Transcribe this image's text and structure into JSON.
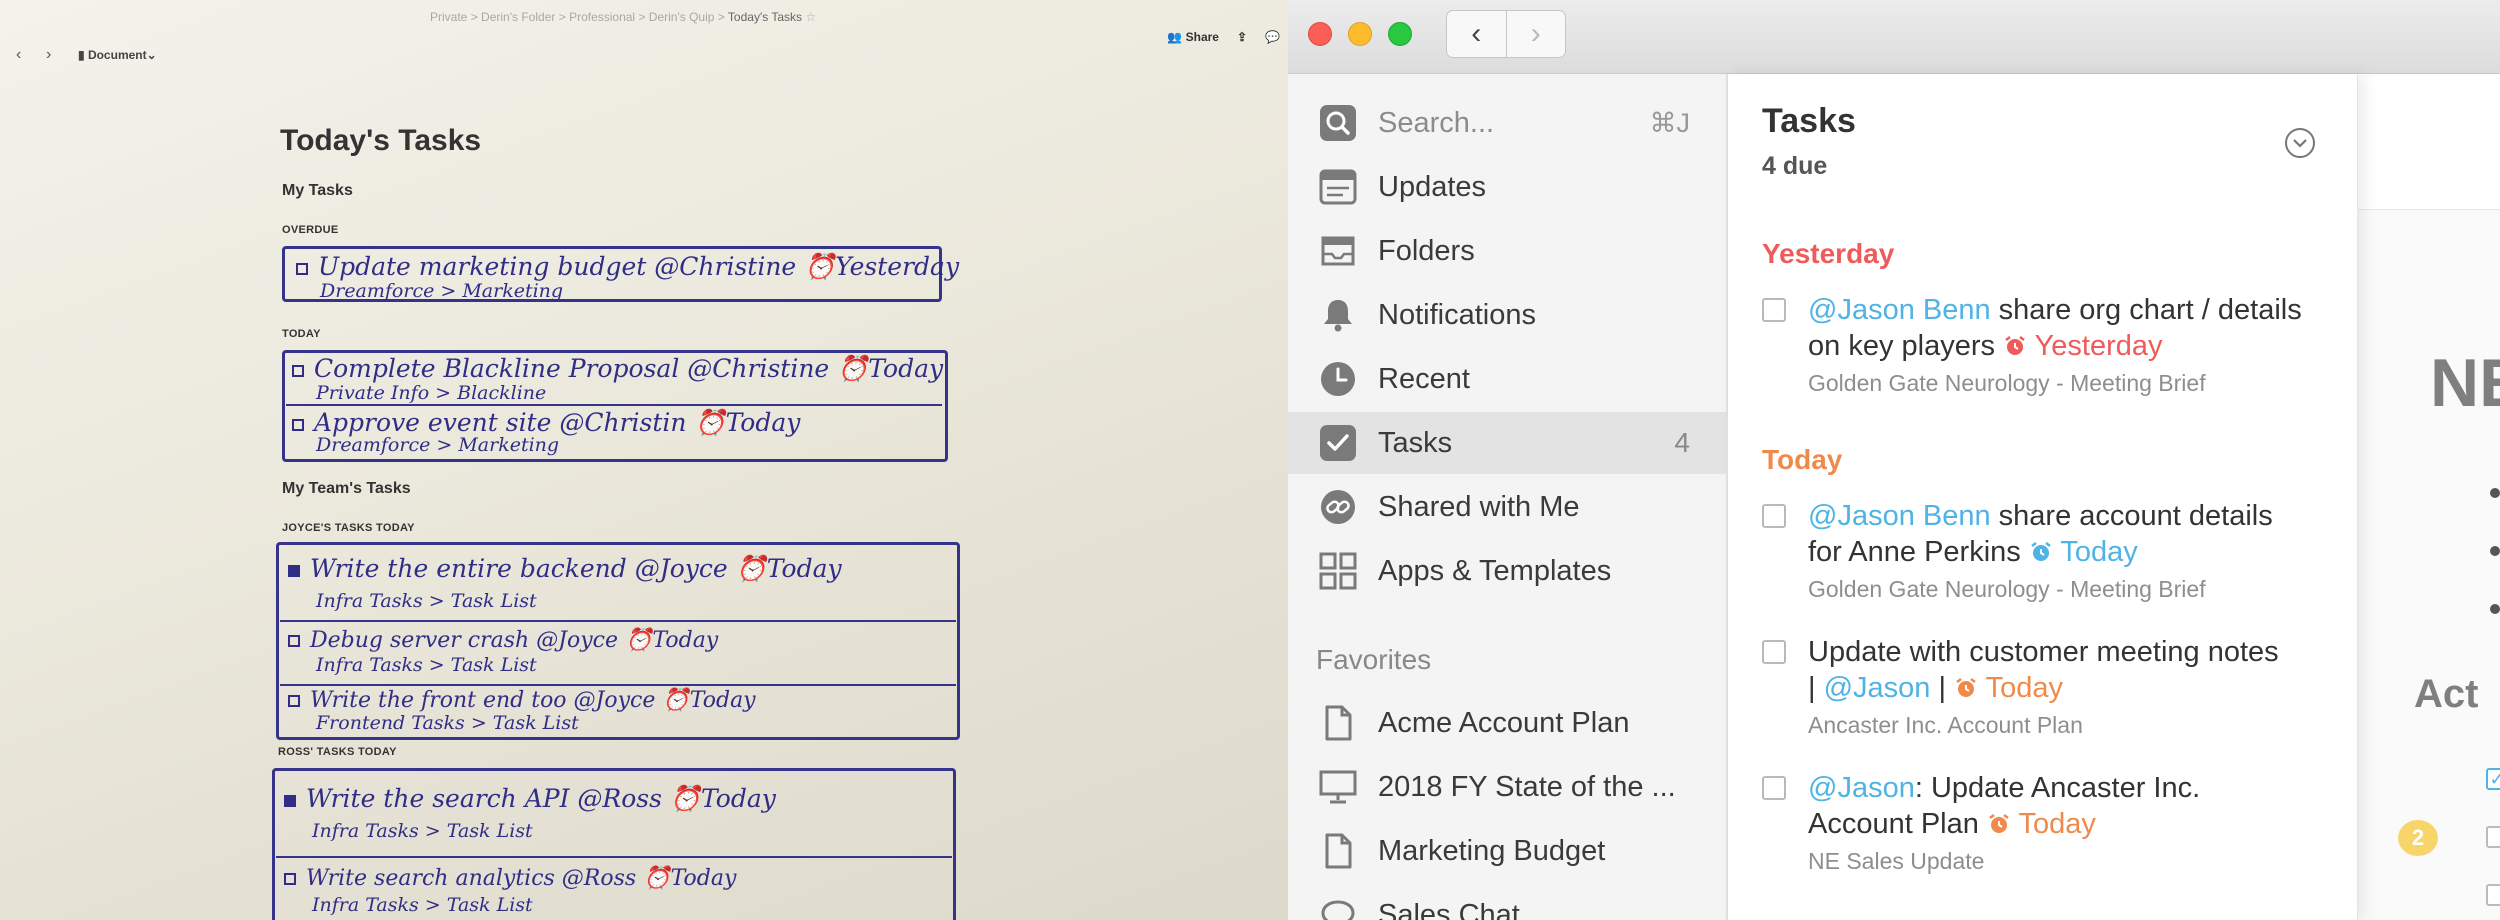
{
  "paper": {
    "breadcrumb": [
      "Private",
      "Derin's Folder",
      "Professional",
      "Derin's Quip",
      "Today's Tasks"
    ],
    "document_menu": "Document",
    "share_label": "Share",
    "page_title": "Today's Tasks",
    "my_tasks_heading": "My Tasks",
    "overdue_caption": "OVERDUE",
    "today_caption": "TODAY",
    "team_heading": "My Team's Tasks",
    "joyce_caption": "JOYCE'S TASKS TODAY",
    "ross_caption": "ROSS' TASKS TODAY",
    "overdue_items": [
      {
        "main": "Update marketing budget @Christine ⏰Yesterday",
        "sub": "Dreamforce > Marketing"
      }
    ],
    "today_items": [
      {
        "main": "Complete Blackline Proposal @Christine ⏰Today",
        "sub": "Private Info > Blackline"
      },
      {
        "main": "Approve event site @Christin ⏰Today",
        "sub": "Dreamforce > Marketing"
      }
    ],
    "joyce_items": [
      {
        "main": "Write the entire backend @Joyce ⏰Today",
        "sub": "Infra Tasks > Task List"
      },
      {
        "main": "Debug server crash @Joyce ⏰Today",
        "sub": "Infra Tasks > Task List"
      },
      {
        "main": "Write the front end too @Joyce ⏰Today",
        "sub": "Frontend Tasks > Task List"
      }
    ],
    "ross_items": [
      {
        "main": "Write the search API @Ross ⏰Today",
        "sub": "Infra Tasks > Task List"
      },
      {
        "main": "Write search analytics @Ross ⏰Today",
        "sub": "Infra Tasks > Task List"
      }
    ]
  },
  "app": {
    "sidebar": {
      "search_placeholder": "Search...",
      "search_shortcut": "⌘J",
      "items": [
        {
          "label": "Updates",
          "icon": "updates-icon"
        },
        {
          "label": "Folders",
          "icon": "folders-icon"
        },
        {
          "label": "Notifications",
          "icon": "bell-icon"
        },
        {
          "label": "Recent",
          "icon": "clock-icon"
        },
        {
          "label": "Tasks",
          "icon": "checkbox-icon",
          "count": "4"
        },
        {
          "label": "Shared with Me",
          "icon": "link-icon"
        },
        {
          "label": "Apps & Templates",
          "icon": "grid-icon"
        }
      ],
      "favorites_heading": "Favorites",
      "favorites": [
        {
          "label": "Acme Account Plan",
          "icon": "document-icon"
        },
        {
          "label": "2018 FY State of the ...",
          "icon": "presentation-icon"
        },
        {
          "label": "Marketing Budget",
          "icon": "document-icon"
        },
        {
          "label": "Sales Chat",
          "icon": "chat-icon"
        }
      ]
    },
    "tasks_panel": {
      "title": "Tasks",
      "due": "4 due",
      "groups": [
        {
          "label": "Yesterday",
          "color": "#ef5a5a"
        },
        {
          "label": "Today",
          "color": "#f08a4b"
        }
      ],
      "items": [
        {
          "mention": "@Jason Benn",
          "text_a": " share org chart / details",
          "text_b": "on key players ",
          "due": "Yesterday",
          "source": "Golden Gate Neurology - Meeting Brief"
        },
        {
          "mention": "@Jason Benn",
          "text_a": " share account details",
          "text_b": "for Anne Perkins ",
          "due": "Today",
          "source": "Golden Gate Neurology - Meeting Brief"
        },
        {
          "text_a": "Update with customer meeting notes",
          "pipe": "|",
          "mention": "@Jason",
          "pipe2": "|",
          "due": "Today",
          "source": "Ancaster Inc. Account Plan"
        },
        {
          "mention": "@Jason",
          "text_a": ": Update Ancaster Inc.",
          "text_b": "Account Plan ",
          "due": "Today",
          "source": "NE Sales Update"
        }
      ]
    },
    "doc_peek": {
      "title_fragment": "NE",
      "section_fragment": "Act",
      "comment_count": "2"
    },
    "colors": {
      "mention": "#4fb3e6",
      "overdue": "#ef5a5a",
      "today": "#f08a4b"
    }
  }
}
